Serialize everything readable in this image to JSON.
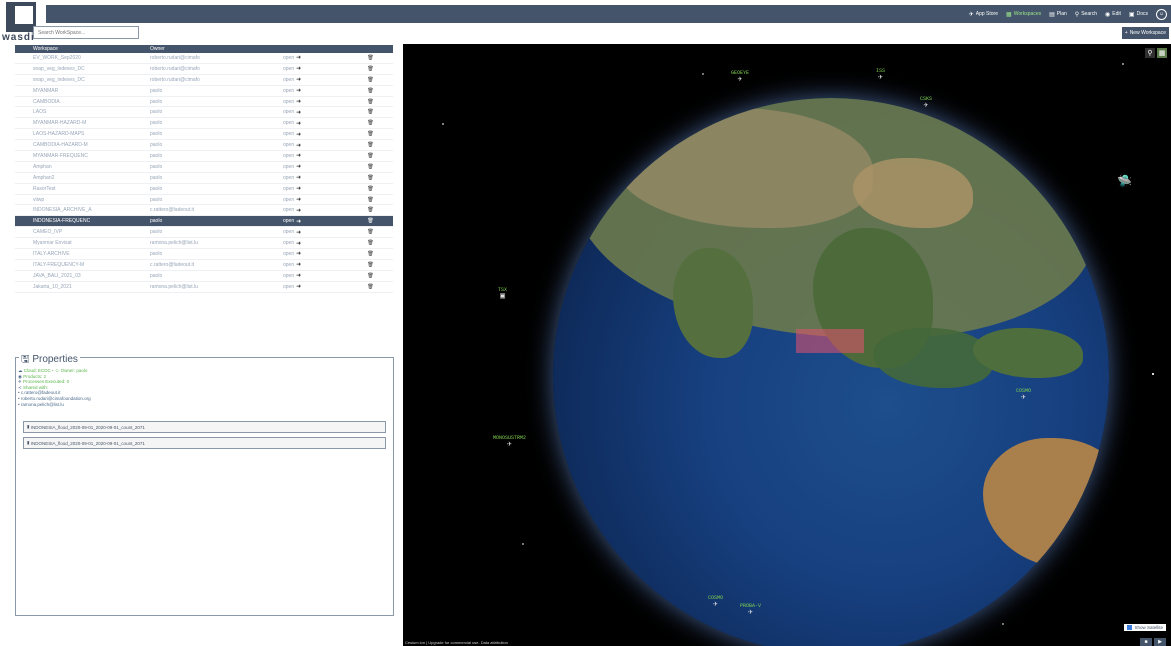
{
  "app": {
    "logo_text": "wasdi"
  },
  "nav": {
    "items": [
      {
        "icon": "✈",
        "label": "App Store",
        "active": false
      },
      {
        "icon": "▦",
        "label": "Workspaces",
        "active": true
      },
      {
        "icon": "▤",
        "label": "Plan",
        "active": false
      },
      {
        "icon": "⚲",
        "label": "Search",
        "active": false
      },
      {
        "icon": "◉",
        "label": "Edit",
        "active": false
      },
      {
        "icon": "▣",
        "label": "Docs",
        "active": false
      }
    ]
  },
  "search": {
    "placeholder": "Search WorkSpace..."
  },
  "new_workspace": {
    "icon": "+",
    "label": "New Workspace"
  },
  "table": {
    "headers": [
      "Workspace",
      "Owner",
      "",
      ""
    ],
    "open_label": "open",
    "selected_index": 15,
    "rows": [
      {
        "name": "EV_WORK_Sep2020",
        "owner": "roberto.rudari@cimafo"
      },
      {
        "name": "snap_veg_indexes_DC",
        "owner": "roberto.rudari@cimafo"
      },
      {
        "name": "snap_veg_indexes_DC",
        "owner": "roberto.rudari@cimafo"
      },
      {
        "name": "MYANMAR",
        "owner": "paolo"
      },
      {
        "name": "CAMBODIA",
        "owner": "paolo"
      },
      {
        "name": "LAOS",
        "owner": "paolo"
      },
      {
        "name": "MYANMAR-HAZARD-M",
        "owner": "paolo"
      },
      {
        "name": "LAOS-HAZARD-MAPS",
        "owner": "paolo"
      },
      {
        "name": "CAMBODIA-HAZARD-M",
        "owner": "paolo"
      },
      {
        "name": "MYANMAR-FREQUENC",
        "owner": "paolo"
      },
      {
        "name": "Amphan",
        "owner": "paolo"
      },
      {
        "name": "Amphan2",
        "owner": "paolo"
      },
      {
        "name": "RasorTest",
        "owner": "paolo"
      },
      {
        "name": "viiwp",
        "owner": "paolo"
      },
      {
        "name": "INDONESIA_ARCHIVE_A",
        "owner": "c.rattero@fadeout.it"
      },
      {
        "name": "INDONESIA-FREQUENC",
        "owner": "paolo"
      },
      {
        "name": "CAMEO_IVP",
        "owner": "paolo"
      },
      {
        "name": "Myanmar Envisat",
        "owner": "ramona.pelich@list.lu"
      },
      {
        "name": "ITALY-ARCHIVE",
        "owner": "paolo"
      },
      {
        "name": "ITALY-FREQUENCY-M",
        "owner": "c.rattero@fadeout.it"
      },
      {
        "name": "JAVA_BALI_2021_03",
        "owner": "paolo"
      },
      {
        "name": "Jakarta_10_2021",
        "owner": "ramona.pelich@list.lu"
      }
    ]
  },
  "properties": {
    "title": "Properties",
    "cloud_label": "Cloud: ECDC",
    "owner_label": "Owner: paolo",
    "products_label": "Products: 2",
    "processes_label": "Processes Executed: 0",
    "shared_label": "Shared with:",
    "shared_with": [
      "c.rattero@fadeout.it",
      "roberto.rudari@cimafoundation.org",
      "ramona.pelich@list.lu"
    ],
    "products": [
      "INDONESIA_flood_2020-09-01_2020-09-01_count_2071",
      "INDONESIA_flood_2020-09-01_2020-09-01_count_2071"
    ]
  },
  "map": {
    "satellites": [
      "GEOEYE",
      "ISS",
      "COSMO",
      "TSX",
      "MONOSUSTRM2",
      "COSMO",
      "CSKS",
      "PROBA-V"
    ],
    "show_satellites_label": "Show Satellite",
    "attribution": "Cesium ion  |  Upgrade for commercial use.  Data attribution"
  }
}
